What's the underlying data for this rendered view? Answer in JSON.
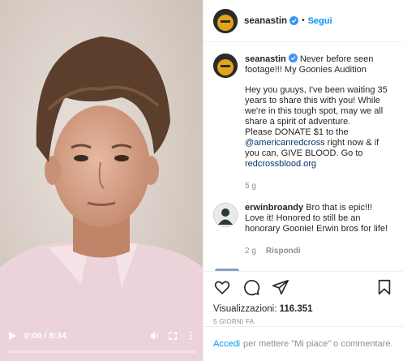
{
  "video": {
    "time": "0:00 / 8:34",
    "progress_fraction": 0.0,
    "play_icon": "play-icon",
    "volume_icon": "volume-icon",
    "fullscreen_icon": "fullscreen-icon",
    "more_icon": "more-vertical-icon"
  },
  "header": {
    "username": "seanastin",
    "separator": "•",
    "follow_label": "Segui"
  },
  "caption": {
    "username": "seanastin",
    "line1": "Never before seen footage!!! My Goonies Audition",
    "para2_a": "Hey you guuys, I've been waiting 35 years to share this with you! While we're in this tough spot, may we all share a spirit of adventure.",
    "para2_b": "Please DONATE $1 to the ",
    "mention": "@americanredcross",
    "para2_c": " right now & if you can, GIVE BLOOD. Go to ",
    "link": "redcrossblood.org",
    "age": "5 g"
  },
  "comments": [
    {
      "username": "erwinbroandy",
      "text": "Bro that is epic!!! Love it! Honored to still be an honorary Goonie! Erwin bros for life!",
      "age": "2 g",
      "reply_label": "Rispondi"
    }
  ],
  "actions": {
    "like_icon": "heart-icon",
    "comment_icon": "comment-icon",
    "share_icon": "share-icon",
    "save_icon": "bookmark-icon"
  },
  "stats": {
    "views_label": "Visualizzazioni: ",
    "views_value": "116.351",
    "date": "5 GIORNI FA"
  },
  "login": {
    "link_label": "Accedi",
    "rest": "per mettere \"Mi piace\" o commentare."
  },
  "colors": {
    "accent": "#0095f6",
    "verified": "#3897f0",
    "link": "#00376b",
    "muted": "#8e8e8e"
  }
}
